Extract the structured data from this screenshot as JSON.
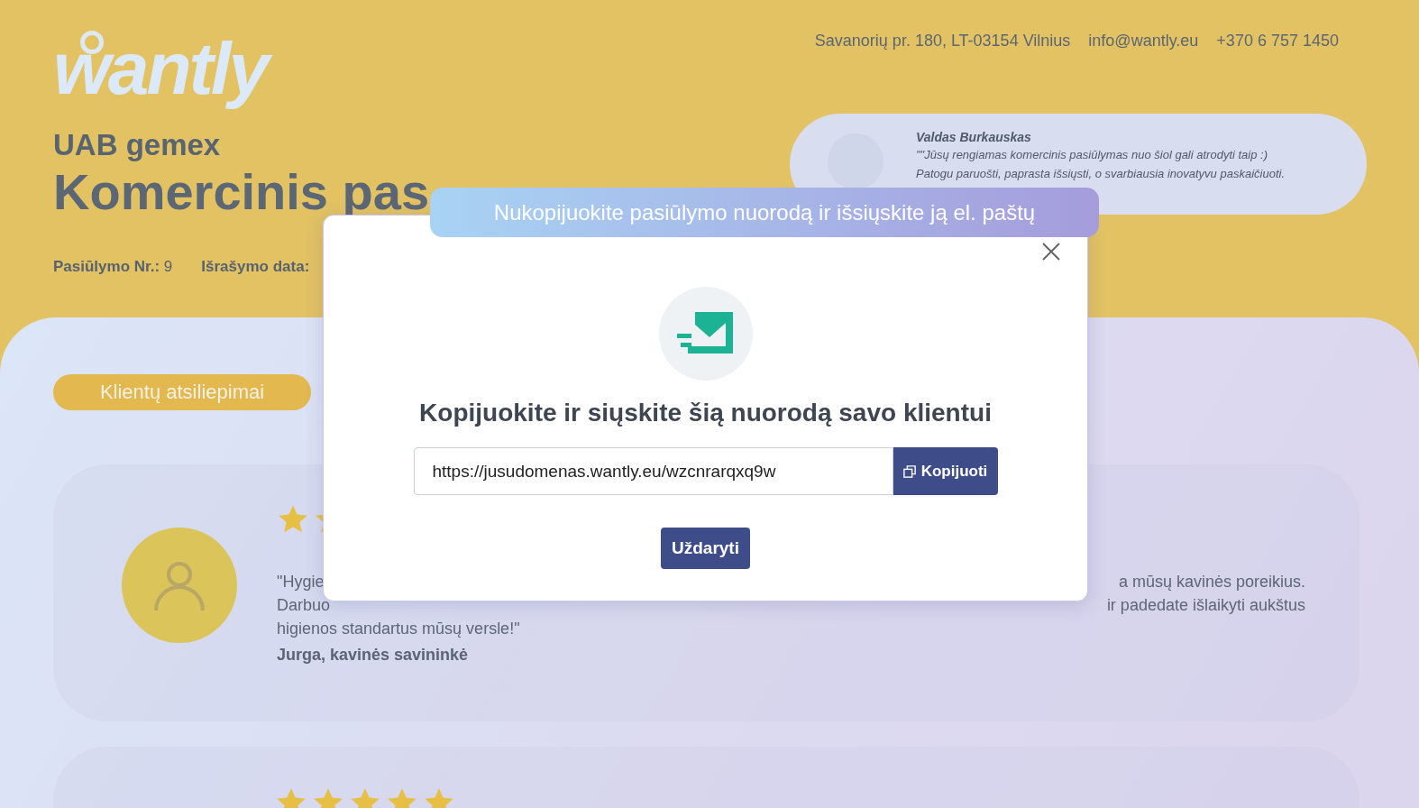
{
  "brand": {
    "logo": "wantly"
  },
  "contacts": [
    "Savanorių pr. 180, LT-03154 Vilnius",
    "info@wantly.eu",
    "+370 6 757 1450"
  ],
  "company": "UAB gemex",
  "title": "Komercinis pas",
  "meta": [
    {
      "label": "Pasiūlymo Nr.:",
      "value": "9"
    },
    {
      "label": "Išrašymo data:"
    }
  ],
  "agent": {
    "name": "Valdas Burkauskas",
    "quote_lines": [
      "\"\"Jūsų rengiamas komercinis pasiūlymas nuo šiol gali atrodyti taip :)",
      "Patogu paruošti, paprasta išsiųsti, o svarbiausia inovatyvu paskaičiuoti."
    ]
  },
  "reviews_tab": "Klientų atsiliepimai",
  "reviews": [
    {
      "lines": [
        {
          "start": "\"Hygie",
          "end": "a mūsų kavinės poreikius."
        },
        {
          "start": "Darbuo",
          "end": "ir padedate išlaikyti aukštus"
        },
        {
          "start": "higienos standartus mūsų versle!\""
        }
      ],
      "author": "Jurga, kavinės savininkė"
    },
    {
      "stars": 5
    }
  ],
  "modal": {
    "banner": "Nukopijuokite pasiūlymo nuorodą ir išsiųskite ją el. paštų",
    "heading": "Kopijuokite ir siųskite šią nuorodą savo klientui",
    "link": "https://jusudomenas.wantly.eu/wzcnrarqxq9w",
    "copy_button": "Kopijuoti",
    "close_button": "Uždaryti"
  }
}
